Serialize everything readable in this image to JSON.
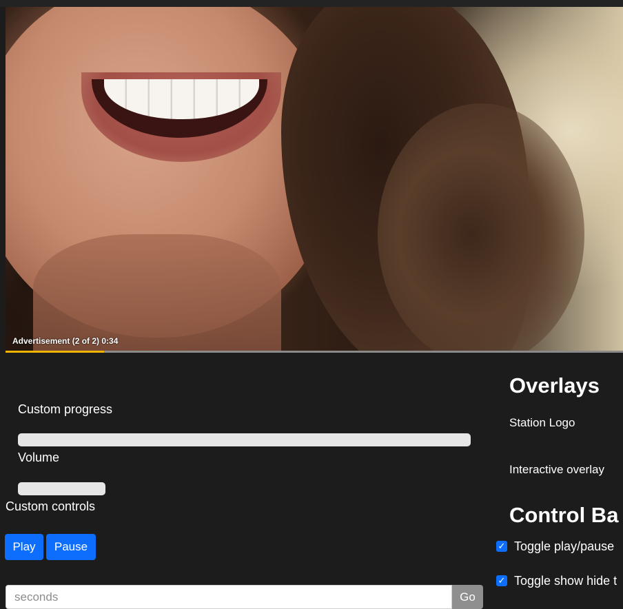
{
  "video": {
    "ad_label": "Advertisement (2 of 2) 0:34",
    "ad_progress_percent": 16
  },
  "left_panel": {
    "custom_progress_label": "Custom progress",
    "volume_label": "Volume",
    "custom_controls_label": "Custom controls",
    "play_label": "Play",
    "pause_label": "Pause",
    "seconds_placeholder": "seconds",
    "go_label": "Go"
  },
  "right_panel": {
    "overlays_heading": "Overlays",
    "station_logo_label": "Station Logo",
    "interactive_overlay_label": "Interactive overlay",
    "control_bar_heading": "Control Ba",
    "checkboxes": [
      {
        "label": "Toggle play/pause",
        "checked": true
      },
      {
        "label": "Toggle show hide t",
        "checked": true
      }
    ]
  },
  "colors": {
    "background": "#1c1c1c",
    "primary_button": "#0d6efd",
    "go_button": "#8f8f8f",
    "ad_progress": "#f0b400"
  }
}
